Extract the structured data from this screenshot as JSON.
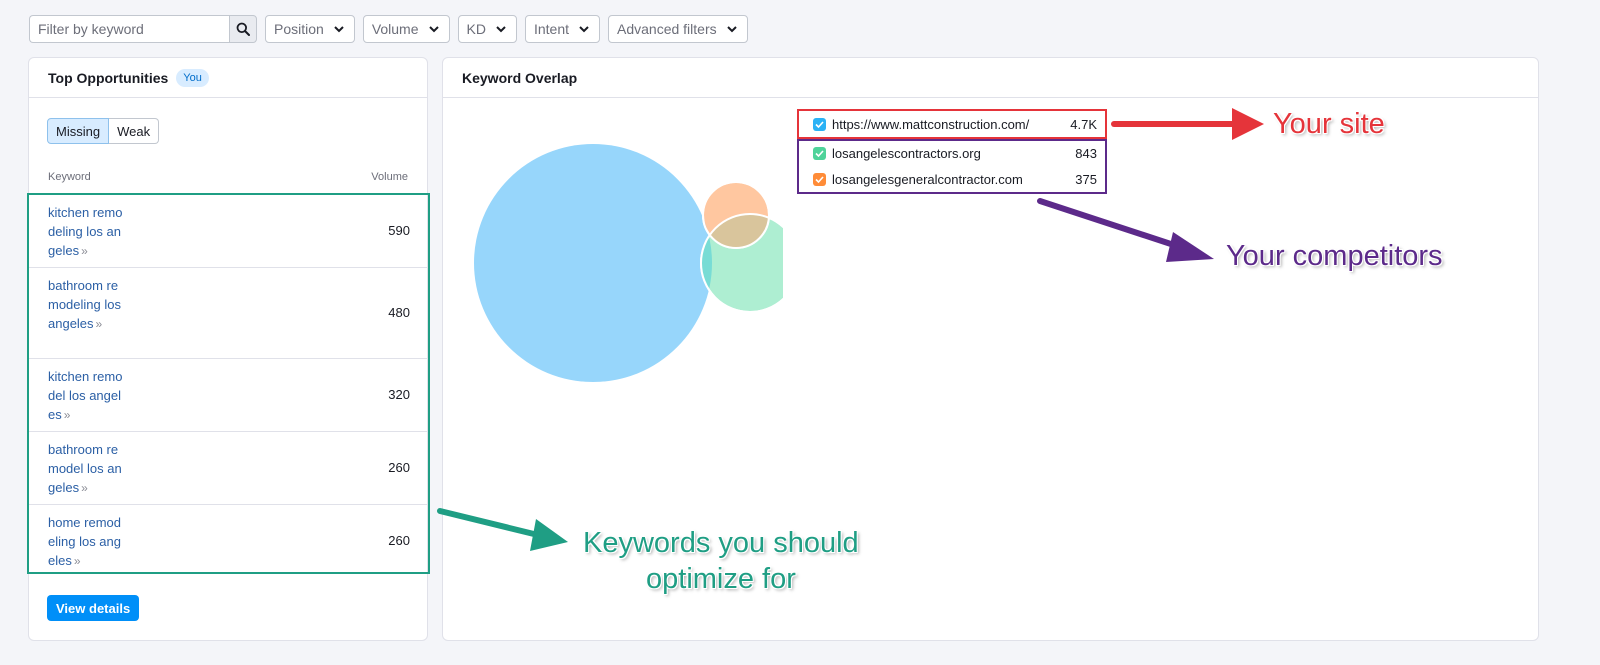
{
  "filters": {
    "keyword_placeholder": "Filter by keyword",
    "search_icon": "search-icon",
    "dropdowns": [
      "Position",
      "Volume",
      "KD",
      "Intent",
      "Advanced filters"
    ]
  },
  "top_opportunities": {
    "title": "Top Opportunities",
    "badge": "You",
    "segments": {
      "missing": "Missing",
      "weak": "Weak",
      "active": "Missing"
    },
    "col_keyword": "Keyword",
    "col_volume": "Volume",
    "rows": [
      {
        "keyword": "kitchen remodeling los angeles",
        "volume": "590"
      },
      {
        "keyword": "bathroom remodeling los angeles",
        "volume": "480"
      },
      {
        "keyword": "kitchen remodel los angeles",
        "volume": "320"
      },
      {
        "keyword": "bathroom remodel los angeles",
        "volume": "260"
      },
      {
        "keyword": "home remodeling los angeles",
        "volume": "260"
      }
    ],
    "view_details": "View details"
  },
  "keyword_overlap": {
    "title": "Keyword Overlap",
    "domains": [
      {
        "domain": "https://www.mattconstruction.com/",
        "count": "4.7K",
        "color": "#2bb2f5"
      },
      {
        "domain": "losangelescontractors.org",
        "count": "843",
        "color": "#4fd39a"
      },
      {
        "domain": "losangelesgeneralcontractor.com",
        "count": "375",
        "color": "#ff8c38"
      }
    ]
  },
  "annotations": {
    "your_site": "Your site",
    "your_competitors": "Your competitors",
    "keywords_line1": "Keywords you should",
    "keywords_line2": "optimize for",
    "red": "#e5343a",
    "purple": "#5c2a8a",
    "green": "#1f9e84"
  }
}
